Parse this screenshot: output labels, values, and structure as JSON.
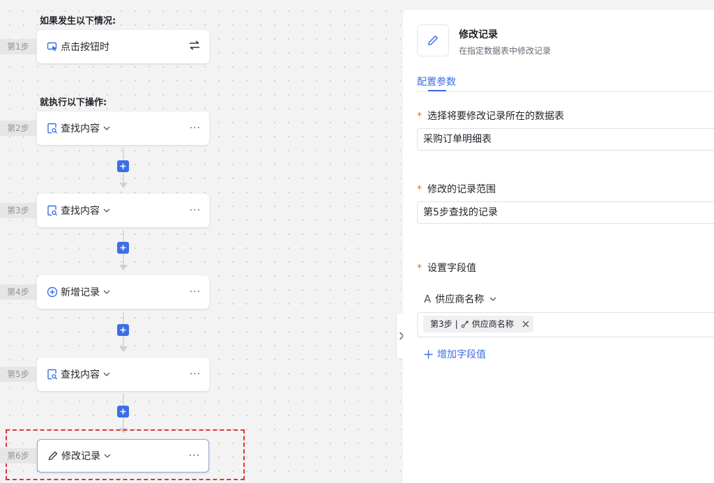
{
  "canvas": {
    "if_title": "如果发生以下情况:",
    "then_title": "就执行以下操作:",
    "trigger": {
      "step": "第1步",
      "label": "点击按钮时"
    },
    "steps": [
      {
        "step": "第2步",
        "label": "查找内容"
      },
      {
        "step": "第3步",
        "label": "查找内容"
      },
      {
        "step": "第4步",
        "label": "新增记录"
      },
      {
        "step": "第5步",
        "label": "查找内容"
      },
      {
        "step": "第6步",
        "label": "修改记录"
      }
    ],
    "more_label": "···"
  },
  "panel": {
    "title": "修改记录",
    "subtitle": "在指定数据表中修改记录",
    "tab": "配置参数",
    "required_mark": "*",
    "table_label": "选择将要修改记录所在的数据表",
    "table_value": "采购订单明细表",
    "range_label": "修改的记录范围",
    "range_value": "第5步查找的记录",
    "fields_label": "设置字段值",
    "field_name": "供应商名称",
    "field_type_glyph": "A",
    "tag_step": "第3步",
    "tag_sep": "|",
    "tag_field": "供应商名称",
    "add_field": "增加字段值"
  },
  "colors": {
    "accent": "#3c6ee6",
    "required": "#e86b1c",
    "highlight": "#e03333"
  }
}
